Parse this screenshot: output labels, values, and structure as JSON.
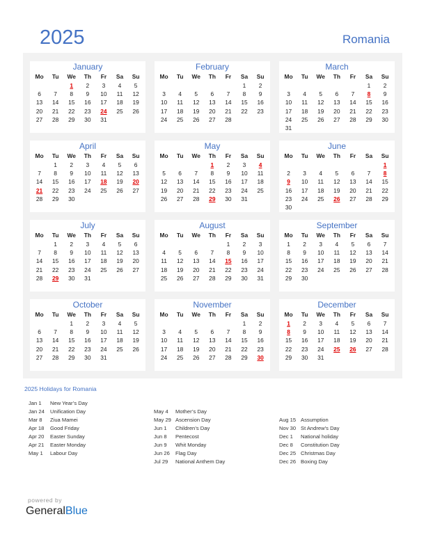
{
  "header": {
    "year": "2025",
    "country": "Romania"
  },
  "weekdays": [
    "Mo",
    "Tu",
    "We",
    "Th",
    "Fr",
    "Sa",
    "Su"
  ],
  "months": [
    {
      "name": "January",
      "start": 2,
      "days": 31,
      "holidays": [
        1,
        24
      ]
    },
    {
      "name": "February",
      "start": 5,
      "days": 28,
      "holidays": []
    },
    {
      "name": "March",
      "start": 5,
      "days": 31,
      "holidays": [
        8
      ]
    },
    {
      "name": "April",
      "start": 1,
      "days": 30,
      "holidays": [
        18,
        20,
        21
      ]
    },
    {
      "name": "May",
      "start": 3,
      "days": 31,
      "holidays": [
        1,
        4,
        29
      ]
    },
    {
      "name": "June",
      "start": 6,
      "days": 30,
      "holidays": [
        1,
        8,
        9,
        26
      ]
    },
    {
      "name": "July",
      "start": 1,
      "days": 31,
      "holidays": [
        29
      ]
    },
    {
      "name": "August",
      "start": 4,
      "days": 31,
      "holidays": [
        15
      ]
    },
    {
      "name": "September",
      "start": 0,
      "days": 30,
      "holidays": []
    },
    {
      "name": "October",
      "start": 2,
      "days": 31,
      "holidays": []
    },
    {
      "name": "November",
      "start": 5,
      "days": 30,
      "holidays": [
        30
      ]
    },
    {
      "name": "December",
      "start": 0,
      "days": 31,
      "holidays": [
        1,
        8,
        25,
        26
      ]
    }
  ],
  "holidays_title": "2025 Holidays for Romania",
  "holiday_columns": [
    [
      {
        "date": "Jan 1",
        "name": "New Year’s Day"
      },
      {
        "date": "Jan 24",
        "name": "Unification Day"
      },
      {
        "date": "Mar 8",
        "name": "Ziua Mamei"
      },
      {
        "date": "Apr 18",
        "name": "Good Friday"
      },
      {
        "date": "Apr 20",
        "name": "Easter Sunday"
      },
      {
        "date": "Apr 21",
        "name": "Easter Monday"
      },
      {
        "date": "May 1",
        "name": "Labour Day"
      }
    ],
    [
      {
        "date": "May 4",
        "name": "Mother’s Day"
      },
      {
        "date": "May 29",
        "name": "Ascension Day"
      },
      {
        "date": "Jun 1",
        "name": "Children’s Day"
      },
      {
        "date": "Jun 8",
        "name": "Pentecost"
      },
      {
        "date": "Jun 9",
        "name": "Whit Monday"
      },
      {
        "date": "Jun 26",
        "name": "Flag Day"
      },
      {
        "date": "Jul 29",
        "name": "National Anthem Day"
      }
    ],
    [
      {
        "date": "Aug 15",
        "name": "Assumption"
      },
      {
        "date": "Nov 30",
        "name": "St Andrew’s Day"
      },
      {
        "date": "Dec 1",
        "name": "National holiday"
      },
      {
        "date": "Dec 8",
        "name": "Constitution Day"
      },
      {
        "date": "Dec 25",
        "name": "Christmas Day"
      },
      {
        "date": "Dec 26",
        "name": "Boxing Day"
      }
    ]
  ],
  "footer": {
    "powered_by": "powered by",
    "brand_general": "General",
    "brand_blue": "Blue"
  }
}
